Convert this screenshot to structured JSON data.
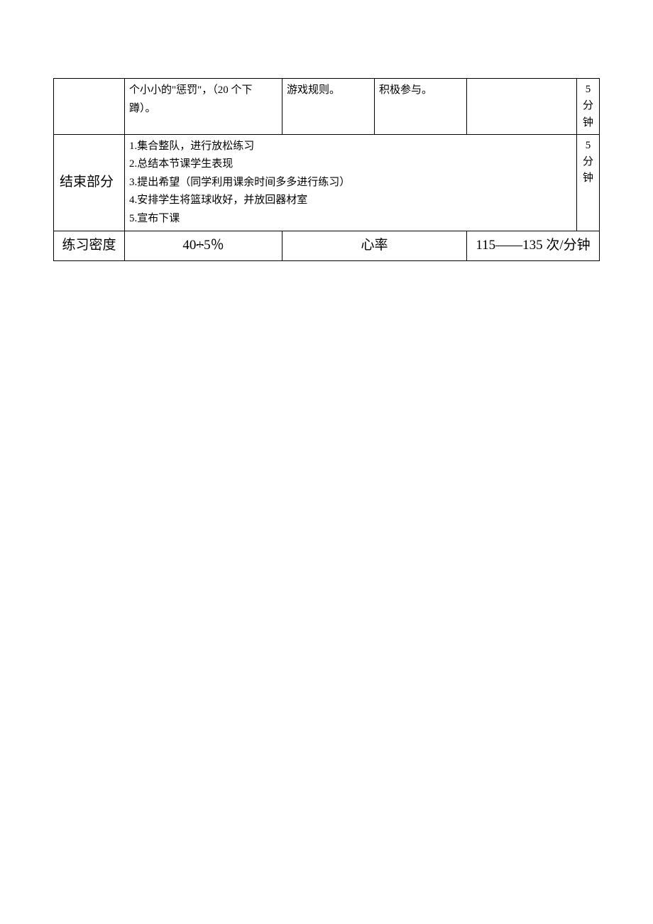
{
  "row1": {
    "col2": "个小小的\"惩罚\"，（20 个下蹲）。",
    "col3": "游戏规则。",
    "col4": "积极参与。",
    "col6": "5分钟"
  },
  "row2": {
    "label": "结束部分",
    "items": [
      "1.集合整队，进行放松练习",
      "2.总结本节课学生表现",
      "3.提出希望（同学利用课余时间多多进行练习）",
      "4.安排学生将篮球收好，并放回器材室",
      "5.宣布下课"
    ],
    "col6": "5分钟"
  },
  "row3": {
    "label1": "练习密度",
    "value1_prefix": "40",
    "value1_underline": "+",
    "value1_suffix": "5％",
    "label2": "心率",
    "value2": "115——135 次/分钟"
  }
}
